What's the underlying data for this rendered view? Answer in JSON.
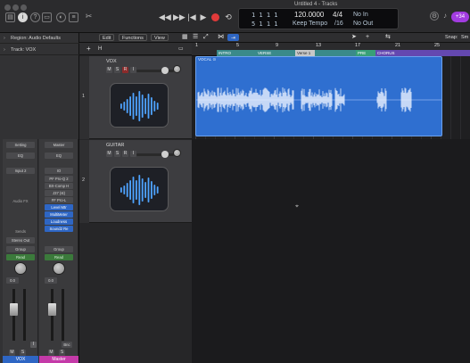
{
  "window": {
    "title": "Untitled 4 - Tracks"
  },
  "toolbar": {
    "left_icons": [
      "library-icon",
      "inspector-icon",
      "help-icon",
      "toolbar-icon",
      "smart-controls-icon",
      "mixer-icon",
      "editors-icon",
      "scissors-icon"
    ],
    "transport_icons": [
      "rewind-icon",
      "fast-forward-icon",
      "go-to-start-icon",
      "play-icon",
      "record-icon",
      "cycle-icon"
    ],
    "lcd": {
      "pos_bars": "1  1  1     1",
      "pos_bars2": "5  1  1     1",
      "tempo": "120.0000",
      "tempo_label": "Keep Tempo",
      "time_sig": "4/4",
      "division": "/16",
      "in_label": "No In",
      "out_label": "No Out"
    },
    "right_icons": [
      "settings-icon",
      "tuner-icon"
    ],
    "avatar": "+34"
  },
  "inspector": {
    "region_label": "Region: Audio Defaults",
    "track_label": "Track: VOX",
    "strip1": {
      "setting": "Setting",
      "eq": "EQ",
      "input": "Input 2",
      "fx": "Audio FX",
      "sends": "Sends",
      "output": "Stereo Out",
      "group": "Group",
      "automation": "Read",
      "vol_value": "0.0",
      "name": "VOX"
    },
    "strip2": {
      "setting": "Master",
      "eq": "EQ",
      "io": "IO",
      "plugins": [
        "PF Pro-Q 2",
        "BX-Comp H",
        "J37 (st)",
        "FF Pro-L",
        "Level Mtr",
        "MultiMeter",
        "Loudness",
        "Sound2 Re"
      ],
      "group": "Group",
      "automation": "Read",
      "vol_value": "0.0",
      "bounce": "Bnc",
      "name": "Master"
    },
    "ms": {
      "mute": "M",
      "solo": "S",
      "input": "I"
    }
  },
  "tracks_menu": {
    "edit": "Edit",
    "functions": "Functions",
    "view": "View",
    "snap": "Snap:",
    "snap_value": "Sm"
  },
  "tracks": [
    {
      "number": "1",
      "name": "VOX",
      "mute": "M",
      "solo": "S",
      "rec": "R",
      "input": "I"
    },
    {
      "number": "2",
      "name": "GUITAR",
      "mute": "M",
      "solo": "S",
      "rec": "R",
      "input": "I"
    }
  ],
  "ruler": {
    "bars": [
      "1",
      "5",
      "9",
      "13",
      "17",
      "21",
      "25"
    ],
    "markers": [
      {
        "label": "INTRO",
        "color": "#3a8a8a"
      },
      {
        "label": "VERSE",
        "color": "#3a8a8a"
      },
      {
        "label": "Verse 1",
        "color": "#c8c8c8"
      },
      {
        "label": "",
        "color": "#3a8a8a"
      },
      {
        "label": "PRE",
        "color": "#38a078"
      },
      {
        "label": "CHORUS",
        "color": "#6448b0"
      }
    ]
  },
  "region": {
    "name": "VOCAL",
    "loop_icon": "link-icon",
    "color": "#2f6fd0"
  },
  "colors": {
    "accent": "#2e66c4",
    "record": "#e03a3a",
    "master_strip": "#c43aa8",
    "vox_strip": "#2e66c4"
  }
}
